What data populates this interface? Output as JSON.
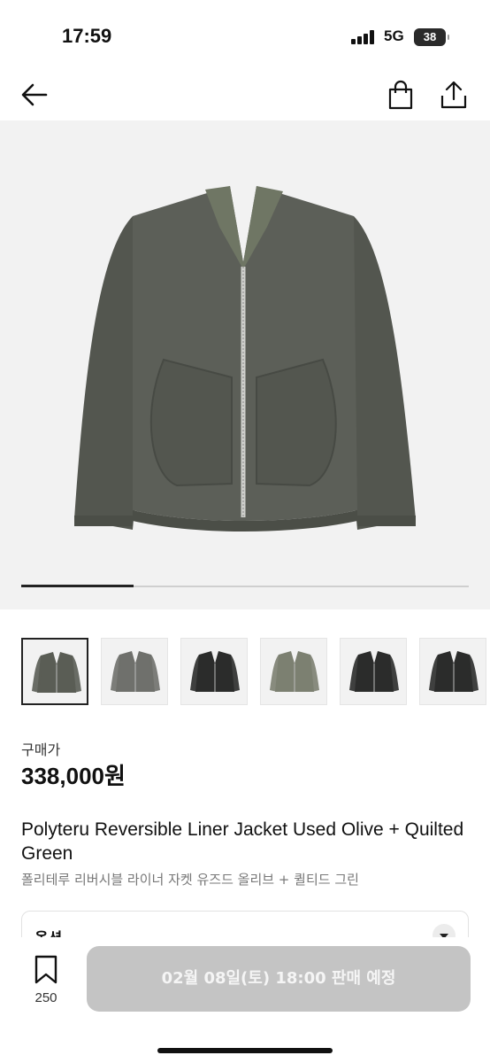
{
  "status_bar": {
    "time": "17:59",
    "network": "5G",
    "battery": "38"
  },
  "nav": {
    "back_icon": "arrow-left-icon",
    "bag_icon": "shopping-bag-icon",
    "share_icon": "share-icon"
  },
  "gallery": {
    "images": 6,
    "current_index": 1,
    "progress_fraction": 0.25,
    "thumbnails": [
      {
        "name": "thumb-used-olive",
        "selected": true
      },
      {
        "name": "thumb-grey",
        "selected": false
      },
      {
        "name": "thumb-black",
        "selected": false
      },
      {
        "name": "thumb-olive-quilted",
        "selected": false
      },
      {
        "name": "thumb-black-quilted",
        "selected": false
      },
      {
        "name": "thumb-black-quilted-2",
        "selected": false
      }
    ]
  },
  "product": {
    "price_label": "구매가",
    "price": "338,000원",
    "title_en": "Polyteru Reversible Liner Jacket Used Olive + Quilted Green",
    "title_ko": "폴리테루 리버시블 라이너 자켓 유즈드 올리브 + 퀼티드 그린"
  },
  "option": {
    "label": "옵션"
  },
  "bottom_bar": {
    "like_icon": "bookmark-icon",
    "like_count": "250",
    "cta_label": "02월 08일(토) 18:00 판매 예정"
  },
  "colors": {
    "jacket_olive": "#5a5d55",
    "jacket_grey": "#6f706c",
    "jacket_black": "#2b2c2b",
    "jacket_green": "#7c8071",
    "cta_disabled": "#c4c4c4"
  }
}
